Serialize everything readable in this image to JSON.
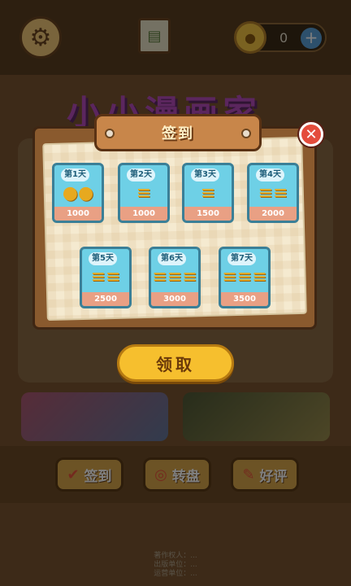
{
  "header": {
    "coin_count": "0",
    "plus_label": "+"
  },
  "background": {
    "game_title": "小小漫画家",
    "bottom_buttons": [
      {
        "label": "签到"
      },
      {
        "label": "转盘"
      },
      {
        "label": "好评"
      }
    ],
    "footer_lines": [
      "著作权人：...",
      "出版单位：...",
      "运营单位：..."
    ]
  },
  "dialog": {
    "title": "签到",
    "close_label": "✕",
    "days": [
      {
        "tag": "第1天",
        "amount": "1000"
      },
      {
        "tag": "第2天",
        "amount": "1000"
      },
      {
        "tag": "第3天",
        "amount": "1500"
      },
      {
        "tag": "第4天",
        "amount": "2000"
      },
      {
        "tag": "第5天",
        "amount": "2500"
      },
      {
        "tag": "第6天",
        "amount": "3000"
      },
      {
        "tag": "第7天",
        "amount": "3500"
      }
    ],
    "claim_label": "领取"
  },
  "colors": {
    "card_bg": "#6ed0e6",
    "card_amount_bg": "#e9a084",
    "claim_button": "#f6bf2e",
    "close_button": "#e44c3c"
  }
}
